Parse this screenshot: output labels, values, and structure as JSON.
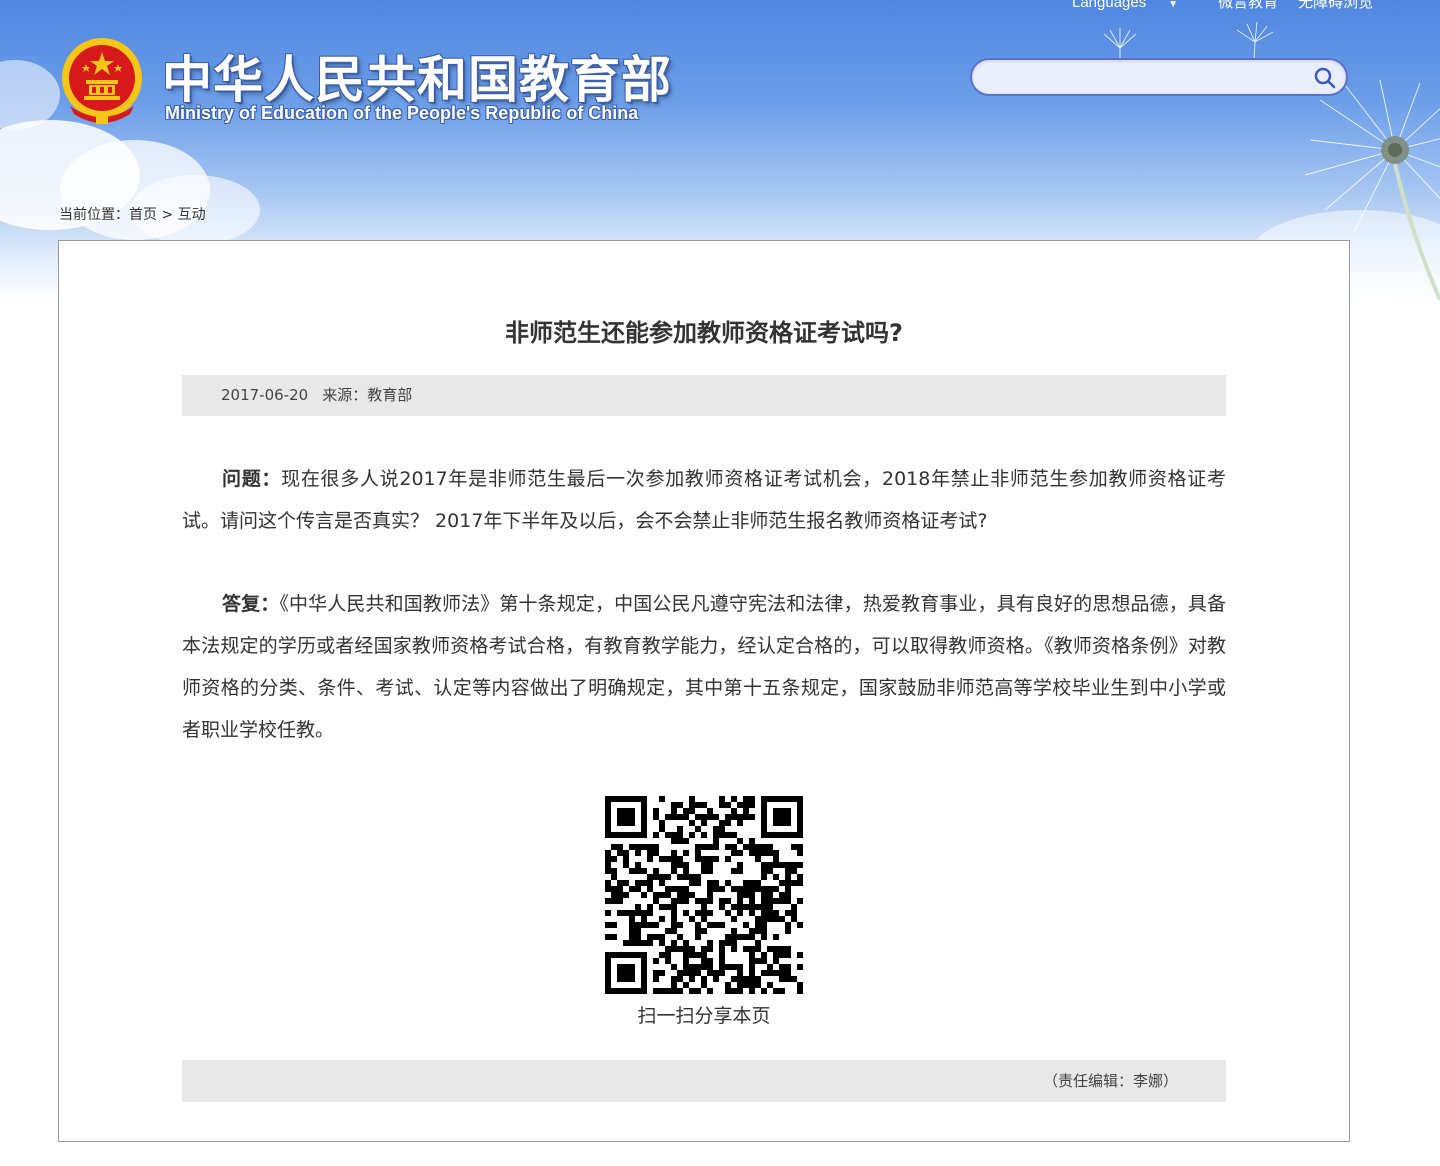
{
  "header": {
    "title_cn": "中华人民共和国教育部",
    "title_en": "Ministry of Education of the People's Republic of China",
    "top_links": {
      "languages": "Languages",
      "weiyan": "微言教育",
      "accessible": "无障碍浏览"
    },
    "search": {
      "value": "",
      "placeholder": ""
    },
    "icons": {
      "emblem": "national-emblem-icon",
      "search": "search-icon",
      "languages_chevron": "chevron-down-icon"
    }
  },
  "breadcrumb": {
    "prefix": "当前位置：",
    "home": "首页",
    "separator": " > ",
    "current": "互动"
  },
  "article": {
    "title": "非师范生还能参加教师资格证考试吗?",
    "date": "2017-06-20",
    "source": "来源：教育部",
    "question_label": "问题：",
    "question_text": "现在很多人说2017年是非师范生最后一次参加教师资格证考试机会，2018年禁止非师范生参加教师资格证考试。请问这个传言是否真实？ 2017年下半年及以后，会不会禁止非师范生报名教师资格证考试?",
    "answer_label": "答复：",
    "answer_text": "《中华人民共和国教师法》第十条规定，中国公民凡遵守宪法和法律，热爱教育事业，具有良好的思想品德，具备本法规定的学历或者经国家教师资格考试合格，有教育教学能力，经认定合格的，可以取得教师资格。《教师资格条例》对教师资格的分类、条件、考试、认定等内容做出了明确规定，其中第十五条规定，国家鼓励非师范高等学校毕业生到中小学或者职业学校任教。",
    "qr_caption": "扫一扫分享本页",
    "editor": "（责任编辑：李娜）"
  },
  "colors": {
    "banner_top": "#4f86e0",
    "emblem_red": "#d7191c",
    "emblem_gold": "#f5c518",
    "search_border": "#5b6fd0",
    "meta_bg": "#e8e8e8",
    "text": "#333333"
  }
}
